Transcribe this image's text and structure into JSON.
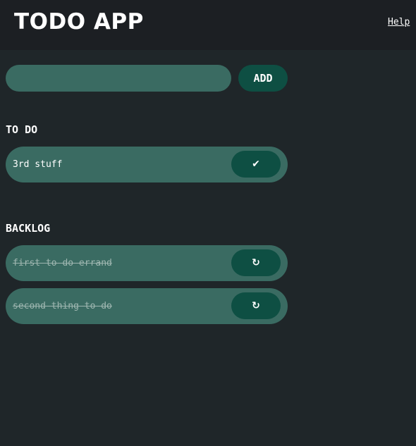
{
  "header": {
    "title": "TODO APP",
    "help_label": "Help"
  },
  "new_task": {
    "value": "",
    "placeholder": "",
    "add_label": "ADD"
  },
  "todo": {
    "title": "TO DO",
    "items": [
      {
        "text": "3rd stuff",
        "action_icon": "check-icon",
        "action_glyph": "✔"
      }
    ]
  },
  "backlog": {
    "title": "BACKLOG",
    "items": [
      {
        "text": "first to do errand",
        "action_icon": "restore-icon",
        "action_glyph": "↻"
      },
      {
        "text": "second thing to do",
        "action_icon": "restore-icon",
        "action_glyph": "↻"
      }
    ]
  },
  "colors": {
    "background": "#1f2629",
    "header": "#1c1f23",
    "item": "#3a6b62",
    "button": "#0e4f43"
  }
}
